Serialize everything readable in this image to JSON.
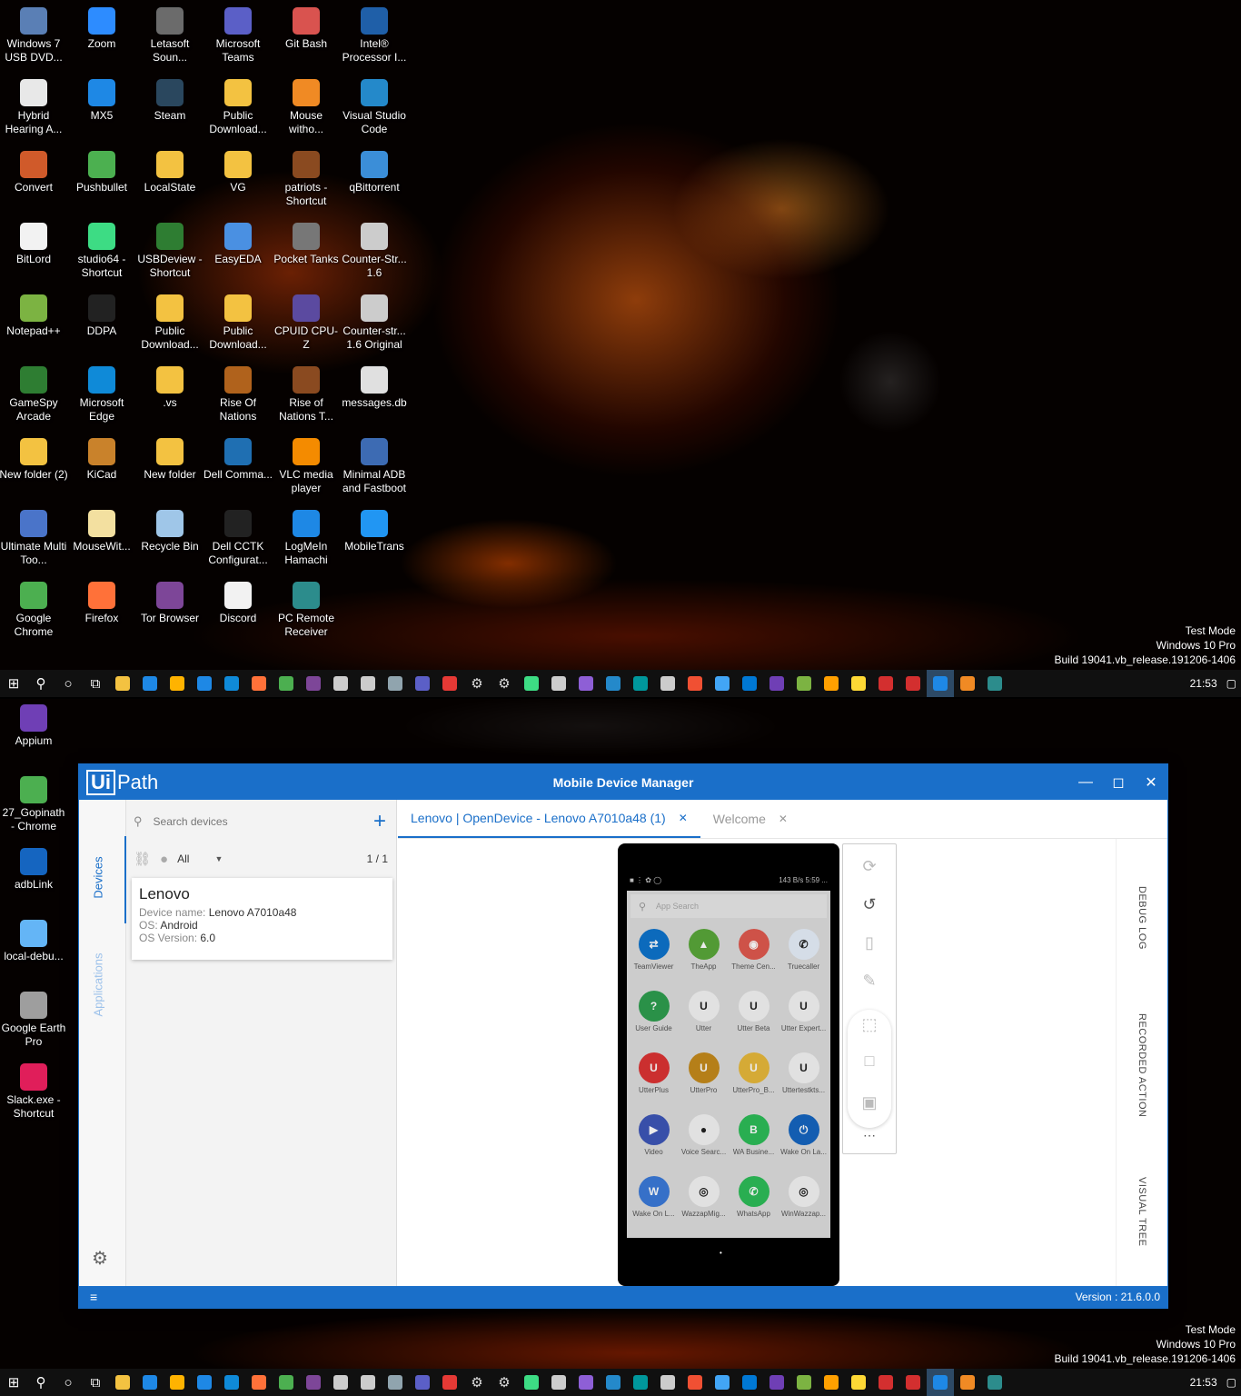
{
  "screen1": {
    "icons": [
      {
        "label": "Windows 7 USB DVD...",
        "icon": "usb-dvd-icon",
        "color": "#5a7fb5"
      },
      {
        "label": "Zoom",
        "icon": "zoom-icon",
        "color": "#2d8cff"
      },
      {
        "label": "Letasoft Soun...",
        "icon": "speaker-icon",
        "color": "#6b6b6b"
      },
      {
        "label": "Microsoft Teams",
        "icon": "teams-icon",
        "color": "#5b5fc7"
      },
      {
        "label": "Git Bash",
        "icon": "git-icon",
        "color": "#d9534f"
      },
      {
        "label": "Intel® Processor I...",
        "icon": "intel-icon",
        "color": "#1f5fa8"
      },
      {
        "label": "Hybrid Hearing A...",
        "icon": "document-icon",
        "color": "#e8e8e8"
      },
      {
        "label": "MX5",
        "icon": "mx5-icon",
        "color": "#1e88e5"
      },
      {
        "label": "Steam",
        "icon": "steam-icon",
        "color": "#2a475e"
      },
      {
        "label": "Public Download...",
        "icon": "folder-shortcut-icon",
        "color": "#f3c241"
      },
      {
        "label": "Mouse witho...",
        "icon": "mouse-icon",
        "color": "#f08a24"
      },
      {
        "label": "Visual Studio Code",
        "icon": "vscode-icon",
        "color": "#2489ca"
      },
      {
        "label": "Convert",
        "icon": "convert-icon",
        "color": "#d05a2a"
      },
      {
        "label": "Pushbullet",
        "icon": "pushbullet-icon",
        "color": "#4cb050"
      },
      {
        "label": "LocalState",
        "icon": "folder-icon",
        "color": "#f3c241"
      },
      {
        "label": "VG",
        "icon": "folder-icon",
        "color": "#f3c241"
      },
      {
        "label": "patriots - Shortcut",
        "icon": "game-icon",
        "color": "#8a4a20"
      },
      {
        "label": "qBittorrent",
        "icon": "qbittorrent-icon",
        "color": "#3b8ed8"
      },
      {
        "label": "BitLord",
        "icon": "bitlord-icon",
        "color": "#f2f2f2"
      },
      {
        "label": "studio64 - Shortcut",
        "icon": "android-studio-icon",
        "color": "#3ddc84"
      },
      {
        "label": "USBDeview - Shortcut",
        "icon": "usb-icon",
        "color": "#2e7d32"
      },
      {
        "label": "EasyEDA",
        "icon": "easyeda-icon",
        "color": "#4a90e2"
      },
      {
        "label": "Pocket Tanks",
        "icon": "tank-icon",
        "color": "#777777"
      },
      {
        "label": "Counter-Str... 1.6",
        "icon": "counter-strike-icon",
        "color": "#cccccc"
      },
      {
        "label": "Notepad++",
        "icon": "notepad-icon",
        "color": "#7cb342"
      },
      {
        "label": "DDPA",
        "icon": "dell-icon",
        "color": "#222222"
      },
      {
        "label": "Public Download...",
        "icon": "folder-shortcut-icon",
        "color": "#f3c241"
      },
      {
        "label": "Public Download...",
        "icon": "folder-shortcut-icon",
        "color": "#f3c241"
      },
      {
        "label": "CPUID CPU-Z",
        "icon": "cpuz-icon",
        "color": "#5b4aa0"
      },
      {
        "label": "Counter-str... 1.6 Original",
        "icon": "counter-strike-icon",
        "color": "#cccccc"
      },
      {
        "label": "GameSpy Arcade",
        "icon": "gamespy-icon",
        "color": "#2e7d32"
      },
      {
        "label": "Microsoft Edge",
        "icon": "edge-icon",
        "color": "#0f8ad8"
      },
      {
        "label": ".vs",
        "icon": "folder-icon",
        "color": "#f3c241"
      },
      {
        "label": "Rise Of Nations",
        "icon": "game-icon",
        "color": "#b0621c"
      },
      {
        "label": "Rise of Nations T...",
        "icon": "game-icon",
        "color": "#8a4a20"
      },
      {
        "label": "messages.db",
        "icon": "database-file-icon",
        "color": "#e0e0e0"
      },
      {
        "label": "New folder (2)",
        "icon": "folder-icon",
        "color": "#f3c241"
      },
      {
        "label": "KiCad",
        "icon": "kicad-icon",
        "color": "#c9822b"
      },
      {
        "label": "New folder",
        "icon": "folder-icon",
        "color": "#f3c241"
      },
      {
        "label": "Dell Comma...",
        "icon": "terminal-icon",
        "color": "#1f6fb2"
      },
      {
        "label": "VLC media player",
        "icon": "vlc-icon",
        "color": "#f48b00"
      },
      {
        "label": "Minimal ADB and Fastboot",
        "icon": "adb-icon",
        "color": "#3d6bb3"
      },
      {
        "label": "Ultimate Multi Too...",
        "icon": "tool-icon",
        "color": "#4a74c9"
      },
      {
        "label": "MouseWit...",
        "icon": "folder-icon",
        "color": "#f3e0a0"
      },
      {
        "label": "Recycle Bin",
        "icon": "recycle-bin-icon",
        "color": "#9fc6e8"
      },
      {
        "label": "Dell CCTK Configurat...",
        "icon": "dell-icon",
        "color": "#222222"
      },
      {
        "label": "LogMeIn Hamachi",
        "icon": "hamachi-icon",
        "color": "#1e88e5"
      },
      {
        "label": "MobileTrans",
        "icon": "mobiletrans-icon",
        "color": "#2196f3"
      },
      {
        "label": "Google Chrome",
        "icon": "chrome-icon",
        "color": "#4caf50"
      },
      {
        "label": "Firefox",
        "icon": "firefox-icon",
        "color": "#ff7139"
      },
      {
        "label": "Tor Browser",
        "icon": "tor-icon",
        "color": "#7d4698"
      },
      {
        "label": "Discord",
        "icon": "document-icon",
        "color": "#f2f2f2"
      },
      {
        "label": "PC Remote Receiver",
        "icon": "remote-icon",
        "color": "#2c8c8c"
      }
    ],
    "watermark": [
      "Test Mode",
      "Windows 10 Pro",
      "Build 19041.vb_release.191206-1406"
    ],
    "clock": "21:53"
  },
  "screen2": {
    "icons": [
      {
        "label": "Appium",
        "icon": "appium-icon",
        "color": "#6f3fb5"
      },
      {
        "label": "27_Gopinath - Chrome",
        "icon": "chrome-icon",
        "color": "#4caf50"
      },
      {
        "label": "adbLink",
        "icon": "adblink-icon",
        "color": "#1565c0"
      },
      {
        "label": "local-debu...",
        "icon": "notepad-icon",
        "color": "#64b5f6"
      },
      {
        "label": "Google Earth Pro",
        "icon": "google-earth-icon",
        "color": "#9e9e9e"
      },
      {
        "label": "Slack.exe - Shortcut",
        "icon": "slack-icon",
        "color": "#e01e5a"
      }
    ],
    "watermark": [
      "Test Mode",
      "Windows 10 Pro",
      "Build 19041.vb_release.191206-1406"
    ],
    "clock": "21:53"
  },
  "uipath": {
    "logo_ui": "Ui",
    "logo_path": "Path",
    "title": "Mobile Device Manager",
    "rail_devices": "Devices",
    "rail_applications": "Applications",
    "search_placeholder": "Search devices",
    "filter_all": "All",
    "count": "1 / 1",
    "device": {
      "name": "Lenovo",
      "device_name_label": "Device name:",
      "device_name": "Lenovo A7010a48",
      "os_label": "OS:",
      "os": "Android",
      "os_version_label": "OS Version:",
      "os_version": "6.0"
    },
    "tabs": [
      {
        "label": "Lenovo | OpenDevice - Lenovo A7010a48 (1)"
      },
      {
        "label": "Welcome"
      }
    ],
    "right_tabs": [
      "DEBUG LOG",
      "RECORDED ACTION",
      "VISUAL TREE"
    ],
    "version": "Version : 21.6.0.0",
    "phone": {
      "search": "App Search",
      "status_right": "143 B/s  5:59 ...",
      "apps": [
        {
          "label": "TeamViewer",
          "color": "#0e73cc",
          "glyph": "⇄"
        },
        {
          "label": "TheApp",
          "color": "#5aa83a",
          "glyph": "▲"
        },
        {
          "label": "Theme Cen...",
          "color": "#e05a4f",
          "glyph": "◉"
        },
        {
          "label": "Truecaller",
          "color": "#e8f0fb",
          "glyph": "✆"
        },
        {
          "label": "User Guide",
          "color": "#2e9e4f",
          "glyph": "?"
        },
        {
          "label": "Utter",
          "color": "#f5f5f5",
          "glyph": "U"
        },
        {
          "label": "Utter Beta",
          "color": "#f5f5f5",
          "glyph": "U"
        },
        {
          "label": "Utter Expert...",
          "color": "#f5f5f5",
          "glyph": "U"
        },
        {
          "label": "UtterPlus",
          "color": "#d33",
          "glyph": "U"
        },
        {
          "label": "UtterPro",
          "color": "#c58a1c",
          "glyph": "U"
        },
        {
          "label": "UtterPro_B...",
          "color": "#e8b93b",
          "glyph": "U"
        },
        {
          "label": "Uttertestkts...",
          "color": "#f5f5f5",
          "glyph": "U"
        },
        {
          "label": "Video",
          "color": "#3d56b8",
          "glyph": "▶"
        },
        {
          "label": "Voice Searc...",
          "color": "#f5f5f5",
          "glyph": "●"
        },
        {
          "label": "WA Busine...",
          "color": "#2dbd58",
          "glyph": "B"
        },
        {
          "label": "Wake On La...",
          "color": "#1565c0",
          "glyph": "⏻"
        },
        {
          "label": "Wake On L...",
          "color": "#3b7ad9",
          "glyph": "W"
        },
        {
          "label": "WazzapMig...",
          "color": "#f5f5f5",
          "glyph": "◎"
        },
        {
          "label": "WhatsApp",
          "color": "#2dbd58",
          "glyph": "✆"
        },
        {
          "label": "WinWazzap...",
          "color": "#f5f5f5",
          "glyph": "◎"
        }
      ]
    }
  }
}
